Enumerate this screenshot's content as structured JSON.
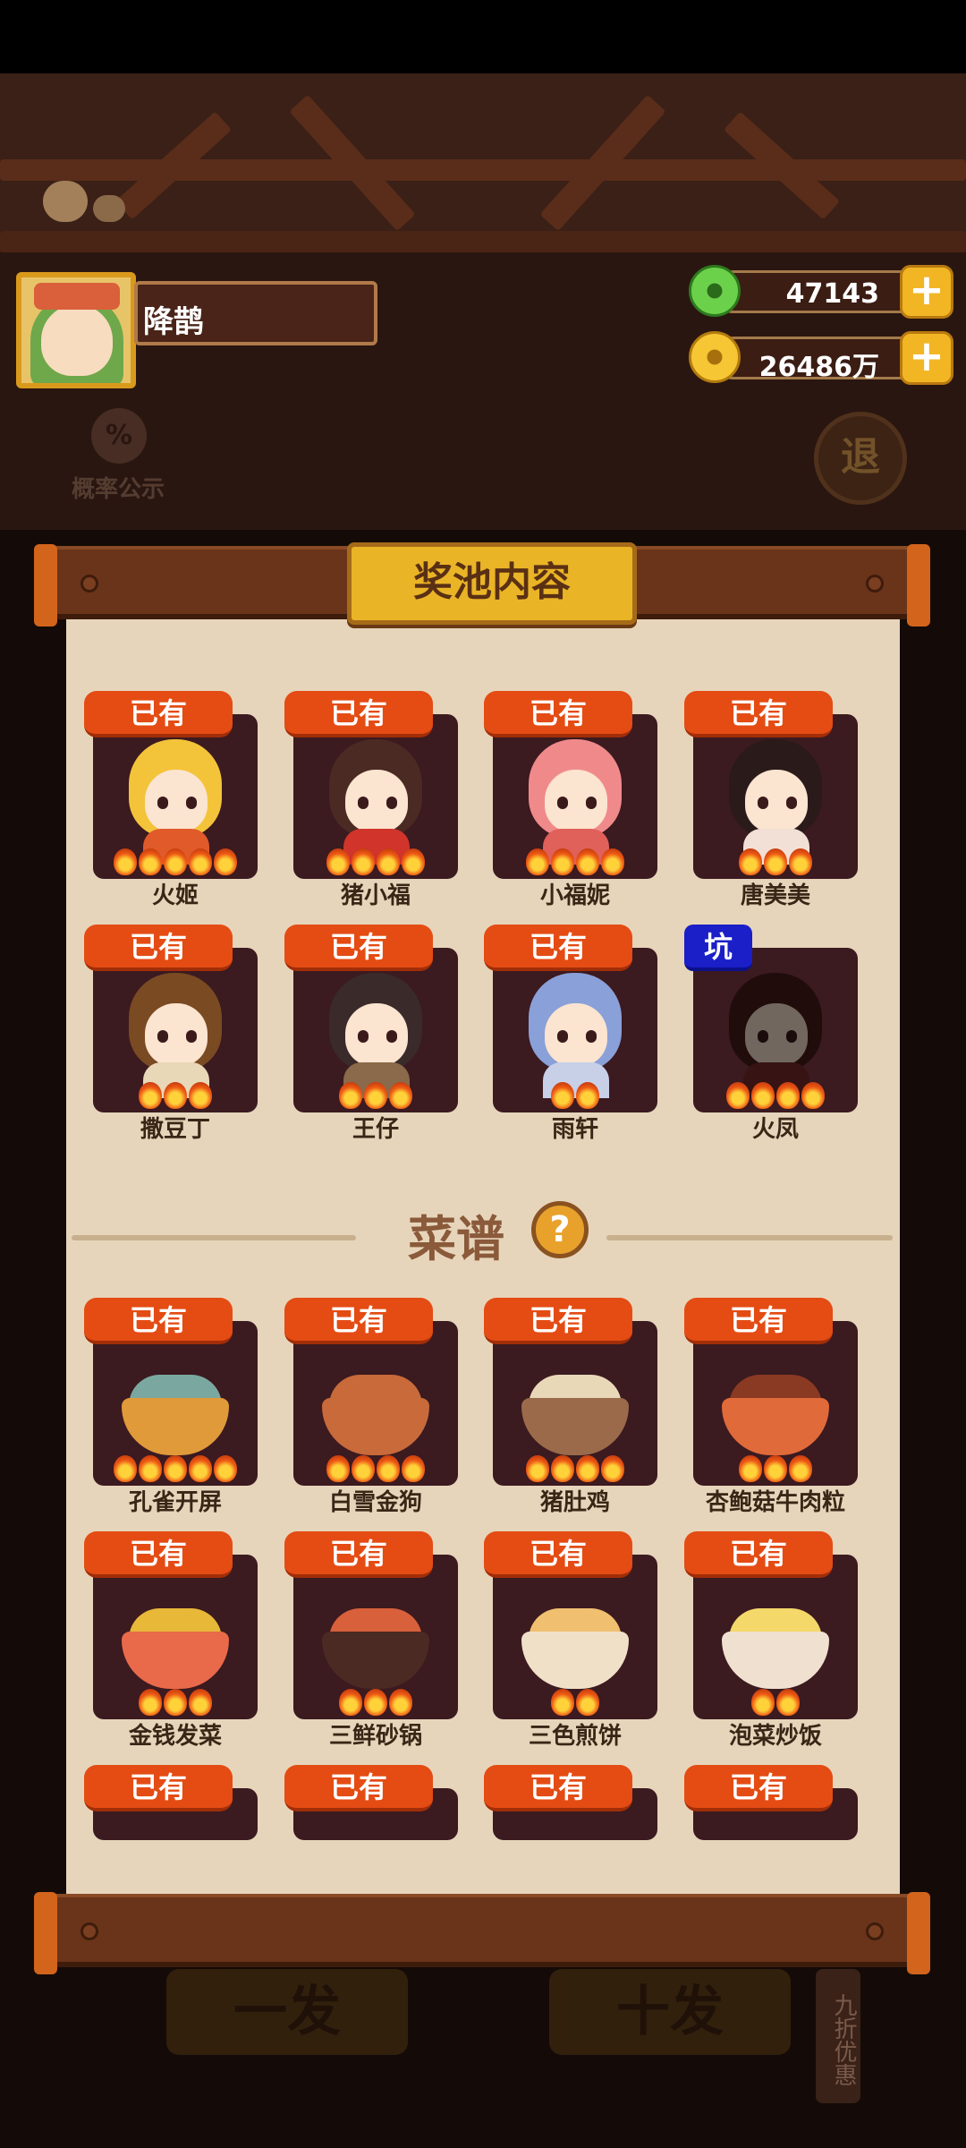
{
  "player": {
    "name": "降鹊"
  },
  "currency": {
    "jade": {
      "icon": "jade-coin-icon",
      "value": "47143"
    },
    "gold": {
      "icon": "gold-coin-icon",
      "value": "26486万"
    },
    "add_label": "+"
  },
  "background": {
    "probability_label": "概率公示",
    "probability_icon_text": "%",
    "exit_label": "退",
    "single_draw_label": "一发",
    "ten_draw_label": "十发",
    "discount_label": "九折优惠"
  },
  "panel": {
    "title": "奖池内容",
    "recipe_section_title": "菜谱",
    "help_label": "?"
  },
  "characters": [
    {
      "name": "火姬",
      "tag": "已有",
      "flames": 5
    },
    {
      "name": "猪小福",
      "tag": "已有",
      "flames": 4
    },
    {
      "name": "小福妮",
      "tag": "已有",
      "flames": 4
    },
    {
      "name": "唐美美",
      "tag": "已有",
      "flames": 3
    },
    {
      "name": "撒豆丁",
      "tag": "已有",
      "flames": 3
    },
    {
      "name": "王仔",
      "tag": "已有",
      "flames": 3
    },
    {
      "name": "雨轩",
      "tag": "已有",
      "flames": 2
    },
    {
      "name": "火凤",
      "tag": "坑",
      "flames": 4
    }
  ],
  "recipes": [
    {
      "name": "孔雀开屏",
      "tag": "已有",
      "flames": 5
    },
    {
      "name": "白雪金狗",
      "tag": "已有",
      "flames": 4
    },
    {
      "name": "猪肚鸡",
      "tag": "已有",
      "flames": 4
    },
    {
      "name": "杏鲍菇牛肉粒",
      "tag": "已有",
      "flames": 3
    },
    {
      "name": "金钱发菜",
      "tag": "已有",
      "flames": 3
    },
    {
      "name": "三鲜砂锅",
      "tag": "已有",
      "flames": 3
    },
    {
      "name": "三色煎饼",
      "tag": "已有",
      "flames": 2
    },
    {
      "name": "泡菜炒饭",
      "tag": "已有",
      "flames": 2
    },
    {
      "name": "",
      "tag": "已有",
      "flames": 0
    },
    {
      "name": "",
      "tag": "已有",
      "flames": 0
    },
    {
      "name": "",
      "tag": "已有",
      "flames": 0
    },
    {
      "name": "",
      "tag": "已有",
      "flames": 0
    }
  ],
  "colors": {
    "owned_tag": "#e44c14",
    "pit_tag": "#1a1fc8",
    "card_bg": "#3b1a20",
    "paper": "#e7d5bb",
    "title_gold": "#eab427"
  }
}
